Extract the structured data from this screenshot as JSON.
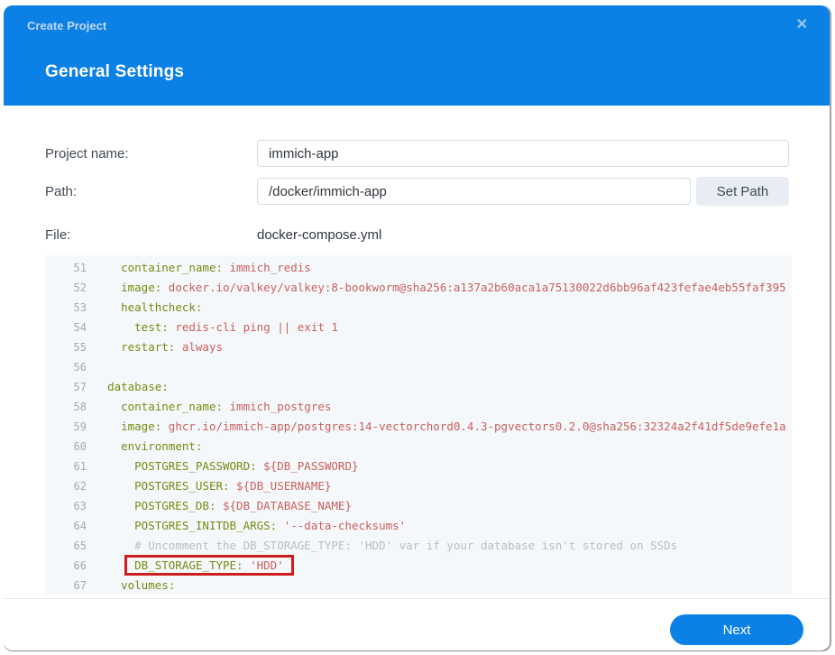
{
  "dialog": {
    "title": "Create Project",
    "close_glyph": "✕",
    "heading": "General Settings"
  },
  "form": {
    "project_name": {
      "label": "Project name:",
      "value": "immich-app"
    },
    "path": {
      "label": "Path:",
      "value": "/docker/immich-app",
      "button_label": "Set Path"
    },
    "file": {
      "label": "File:",
      "value": "docker-compose.yml"
    }
  },
  "editor": {
    "filename": "docker-compose.yml",
    "highlight_color": "#cf1d1d",
    "key_color": "#6f8e12",
    "value_color": "#c9605e",
    "comment_color": "#b9bdc1",
    "lines": [
      {
        "n": 51,
        "indent": 4,
        "segments": [
          {
            "c": "key",
            "t": "container_name:"
          },
          {
            "c": "val",
            "t": " immich_redis"
          }
        ]
      },
      {
        "n": 52,
        "indent": 4,
        "segments": [
          {
            "c": "key",
            "t": "image:"
          },
          {
            "c": "val",
            "t": " docker.io/valkey/valkey:8-bookworm@sha256:a137a2b60aca1a75130022d6bb96af423fefae4eb55faf395"
          }
        ]
      },
      {
        "n": 53,
        "indent": 4,
        "segments": [
          {
            "c": "key",
            "t": "healthcheck:"
          }
        ]
      },
      {
        "n": 54,
        "indent": 6,
        "segments": [
          {
            "c": "key",
            "t": "test:"
          },
          {
            "c": "val",
            "t": " redis-cli ping || exit 1"
          }
        ]
      },
      {
        "n": 55,
        "indent": 4,
        "segments": [
          {
            "c": "key",
            "t": "restart:"
          },
          {
            "c": "val",
            "t": " always"
          }
        ]
      },
      {
        "n": 56,
        "indent": 0,
        "segments": []
      },
      {
        "n": 57,
        "indent": 2,
        "segments": [
          {
            "c": "key",
            "t": "database:"
          }
        ]
      },
      {
        "n": 58,
        "indent": 4,
        "segments": [
          {
            "c": "key",
            "t": "container_name:"
          },
          {
            "c": "val",
            "t": " immich_postgres"
          }
        ]
      },
      {
        "n": 59,
        "indent": 4,
        "segments": [
          {
            "c": "key",
            "t": "image:"
          },
          {
            "c": "val",
            "t": " ghcr.io/immich-app/postgres:14-vectorchord0.4.3-pgvectors0.2.0@sha256:32324a2f41df5de9efe1a"
          }
        ]
      },
      {
        "n": 60,
        "indent": 4,
        "segments": [
          {
            "c": "key",
            "t": "environment:"
          }
        ]
      },
      {
        "n": 61,
        "indent": 6,
        "segments": [
          {
            "c": "key",
            "t": "POSTGRES_PASSWORD:"
          },
          {
            "c": "val",
            "t": " ${DB_PASSWORD}"
          }
        ]
      },
      {
        "n": 62,
        "indent": 6,
        "segments": [
          {
            "c": "key",
            "t": "POSTGRES_USER:"
          },
          {
            "c": "val",
            "t": " ${DB_USERNAME}"
          }
        ]
      },
      {
        "n": 63,
        "indent": 6,
        "segments": [
          {
            "c": "key",
            "t": "POSTGRES_DB:"
          },
          {
            "c": "val",
            "t": " ${DB_DATABASE_NAME}"
          }
        ]
      },
      {
        "n": 64,
        "indent": 6,
        "segments": [
          {
            "c": "key",
            "t": "POSTGRES_INITDB_ARGS:"
          },
          {
            "c": "val",
            "t": " '--data-checksums'"
          }
        ]
      },
      {
        "n": 65,
        "indent": 6,
        "segments": [
          {
            "c": "com",
            "t": "# Uncomment the DB_STORAGE_TYPE: 'HDD' var if your database isn't stored on SSDs"
          }
        ]
      },
      {
        "n": 66,
        "indent": 6,
        "highlight": true,
        "segments": [
          {
            "c": "key",
            "t": "DB_STORAGE_TYPE:"
          },
          {
            "c": "val",
            "t": " 'HDD'"
          }
        ]
      },
      {
        "n": 67,
        "indent": 4,
        "segments": [
          {
            "c": "key",
            "t": "volumes:"
          }
        ]
      }
    ]
  },
  "footer": {
    "next_label": "Next"
  },
  "colors": {
    "header_blue": "#0b80e5",
    "accent_blue": "#0b80e5"
  }
}
